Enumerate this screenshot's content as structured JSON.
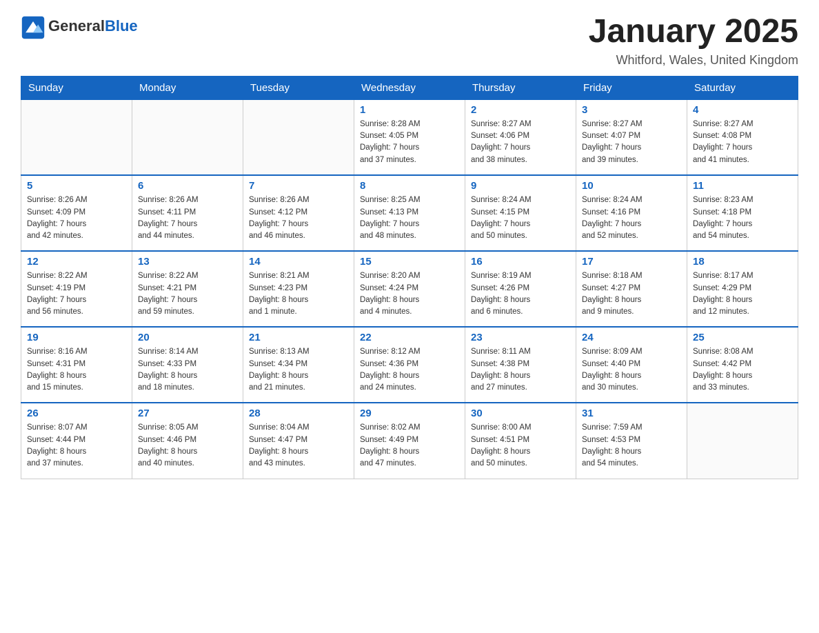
{
  "logo": {
    "general": "General",
    "blue": "Blue"
  },
  "title": "January 2025",
  "location": "Whitford, Wales, United Kingdom",
  "days_of_week": [
    "Sunday",
    "Monday",
    "Tuesday",
    "Wednesday",
    "Thursday",
    "Friday",
    "Saturday"
  ],
  "weeks": [
    [
      {
        "day": "",
        "info": ""
      },
      {
        "day": "",
        "info": ""
      },
      {
        "day": "",
        "info": ""
      },
      {
        "day": "1",
        "info": "Sunrise: 8:28 AM\nSunset: 4:05 PM\nDaylight: 7 hours\nand 37 minutes."
      },
      {
        "day": "2",
        "info": "Sunrise: 8:27 AM\nSunset: 4:06 PM\nDaylight: 7 hours\nand 38 minutes."
      },
      {
        "day": "3",
        "info": "Sunrise: 8:27 AM\nSunset: 4:07 PM\nDaylight: 7 hours\nand 39 minutes."
      },
      {
        "day": "4",
        "info": "Sunrise: 8:27 AM\nSunset: 4:08 PM\nDaylight: 7 hours\nand 41 minutes."
      }
    ],
    [
      {
        "day": "5",
        "info": "Sunrise: 8:26 AM\nSunset: 4:09 PM\nDaylight: 7 hours\nand 42 minutes."
      },
      {
        "day": "6",
        "info": "Sunrise: 8:26 AM\nSunset: 4:11 PM\nDaylight: 7 hours\nand 44 minutes."
      },
      {
        "day": "7",
        "info": "Sunrise: 8:26 AM\nSunset: 4:12 PM\nDaylight: 7 hours\nand 46 minutes."
      },
      {
        "day": "8",
        "info": "Sunrise: 8:25 AM\nSunset: 4:13 PM\nDaylight: 7 hours\nand 48 minutes."
      },
      {
        "day": "9",
        "info": "Sunrise: 8:24 AM\nSunset: 4:15 PM\nDaylight: 7 hours\nand 50 minutes."
      },
      {
        "day": "10",
        "info": "Sunrise: 8:24 AM\nSunset: 4:16 PM\nDaylight: 7 hours\nand 52 minutes."
      },
      {
        "day": "11",
        "info": "Sunrise: 8:23 AM\nSunset: 4:18 PM\nDaylight: 7 hours\nand 54 minutes."
      }
    ],
    [
      {
        "day": "12",
        "info": "Sunrise: 8:22 AM\nSunset: 4:19 PM\nDaylight: 7 hours\nand 56 minutes."
      },
      {
        "day": "13",
        "info": "Sunrise: 8:22 AM\nSunset: 4:21 PM\nDaylight: 7 hours\nand 59 minutes."
      },
      {
        "day": "14",
        "info": "Sunrise: 8:21 AM\nSunset: 4:23 PM\nDaylight: 8 hours\nand 1 minute."
      },
      {
        "day": "15",
        "info": "Sunrise: 8:20 AM\nSunset: 4:24 PM\nDaylight: 8 hours\nand 4 minutes."
      },
      {
        "day": "16",
        "info": "Sunrise: 8:19 AM\nSunset: 4:26 PM\nDaylight: 8 hours\nand 6 minutes."
      },
      {
        "day": "17",
        "info": "Sunrise: 8:18 AM\nSunset: 4:27 PM\nDaylight: 8 hours\nand 9 minutes."
      },
      {
        "day": "18",
        "info": "Sunrise: 8:17 AM\nSunset: 4:29 PM\nDaylight: 8 hours\nand 12 minutes."
      }
    ],
    [
      {
        "day": "19",
        "info": "Sunrise: 8:16 AM\nSunset: 4:31 PM\nDaylight: 8 hours\nand 15 minutes."
      },
      {
        "day": "20",
        "info": "Sunrise: 8:14 AM\nSunset: 4:33 PM\nDaylight: 8 hours\nand 18 minutes."
      },
      {
        "day": "21",
        "info": "Sunrise: 8:13 AM\nSunset: 4:34 PM\nDaylight: 8 hours\nand 21 minutes."
      },
      {
        "day": "22",
        "info": "Sunrise: 8:12 AM\nSunset: 4:36 PM\nDaylight: 8 hours\nand 24 minutes."
      },
      {
        "day": "23",
        "info": "Sunrise: 8:11 AM\nSunset: 4:38 PM\nDaylight: 8 hours\nand 27 minutes."
      },
      {
        "day": "24",
        "info": "Sunrise: 8:09 AM\nSunset: 4:40 PM\nDaylight: 8 hours\nand 30 minutes."
      },
      {
        "day": "25",
        "info": "Sunrise: 8:08 AM\nSunset: 4:42 PM\nDaylight: 8 hours\nand 33 minutes."
      }
    ],
    [
      {
        "day": "26",
        "info": "Sunrise: 8:07 AM\nSunset: 4:44 PM\nDaylight: 8 hours\nand 37 minutes."
      },
      {
        "day": "27",
        "info": "Sunrise: 8:05 AM\nSunset: 4:46 PM\nDaylight: 8 hours\nand 40 minutes."
      },
      {
        "day": "28",
        "info": "Sunrise: 8:04 AM\nSunset: 4:47 PM\nDaylight: 8 hours\nand 43 minutes."
      },
      {
        "day": "29",
        "info": "Sunrise: 8:02 AM\nSunset: 4:49 PM\nDaylight: 8 hours\nand 47 minutes."
      },
      {
        "day": "30",
        "info": "Sunrise: 8:00 AM\nSunset: 4:51 PM\nDaylight: 8 hours\nand 50 minutes."
      },
      {
        "day": "31",
        "info": "Sunrise: 7:59 AM\nSunset: 4:53 PM\nDaylight: 8 hours\nand 54 minutes."
      },
      {
        "day": "",
        "info": ""
      }
    ]
  ]
}
